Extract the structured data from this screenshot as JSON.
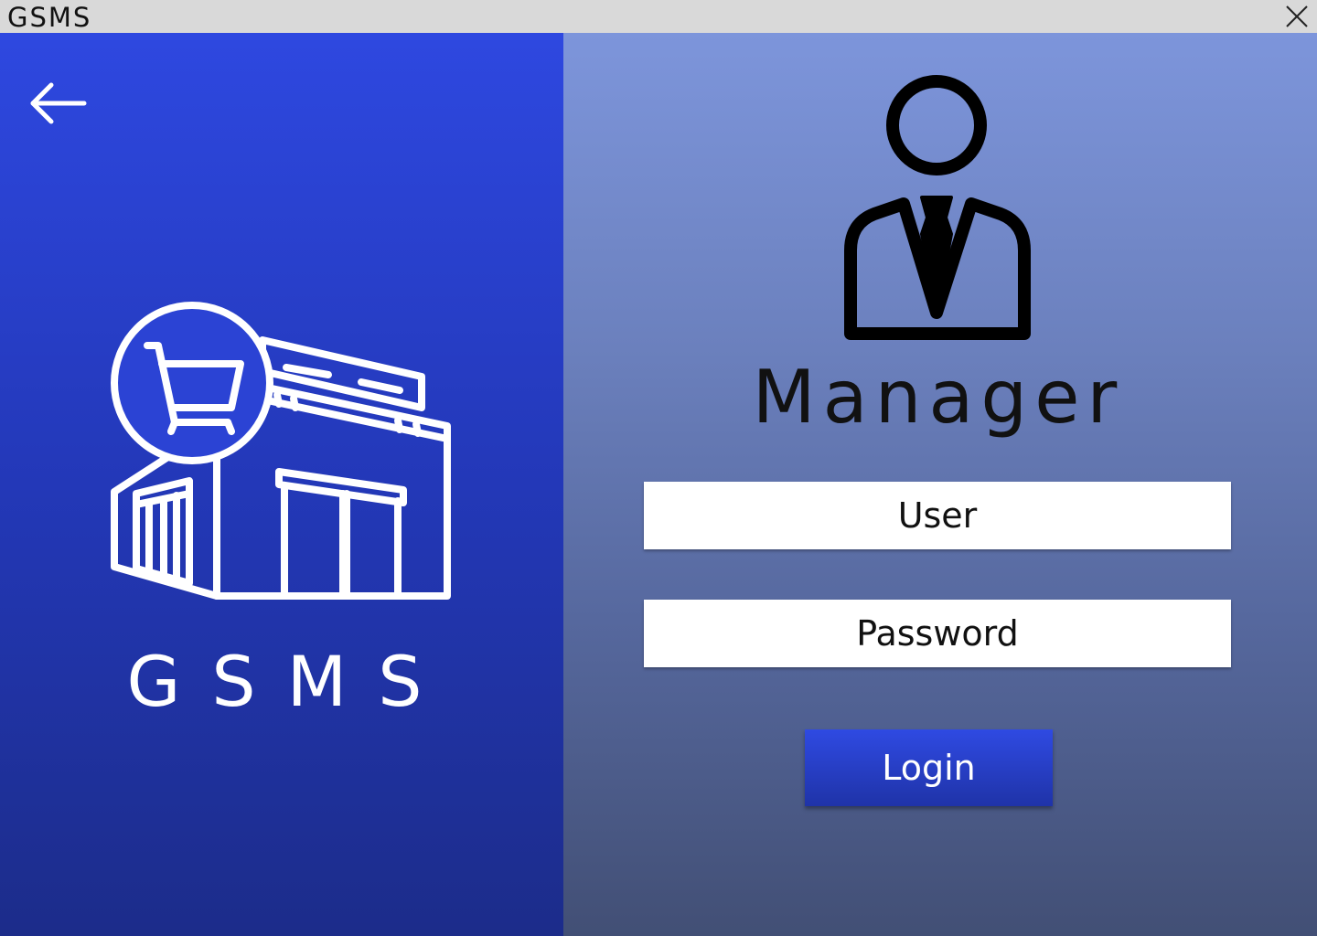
{
  "window": {
    "title": "GSMS",
    "close_icon": "close-icon"
  },
  "left_panel": {
    "back_icon": "arrow-left-icon",
    "logo_icon": "store-cart-icon",
    "brand": "GSMS",
    "colors": {
      "gradient_top": "#2e48e0",
      "gradient_bottom": "#1c2c8a"
    }
  },
  "right_panel": {
    "role_icon": "manager-icon",
    "role_title": "Manager",
    "user_field": {
      "placeholder": "User",
      "value": ""
    },
    "password_field": {
      "placeholder": "Password",
      "value": ""
    },
    "login_label": "Login",
    "colors": {
      "gradient_top": "#7d95db",
      "gradient_bottom": "#424f75",
      "button": "#2f4ae2"
    }
  }
}
